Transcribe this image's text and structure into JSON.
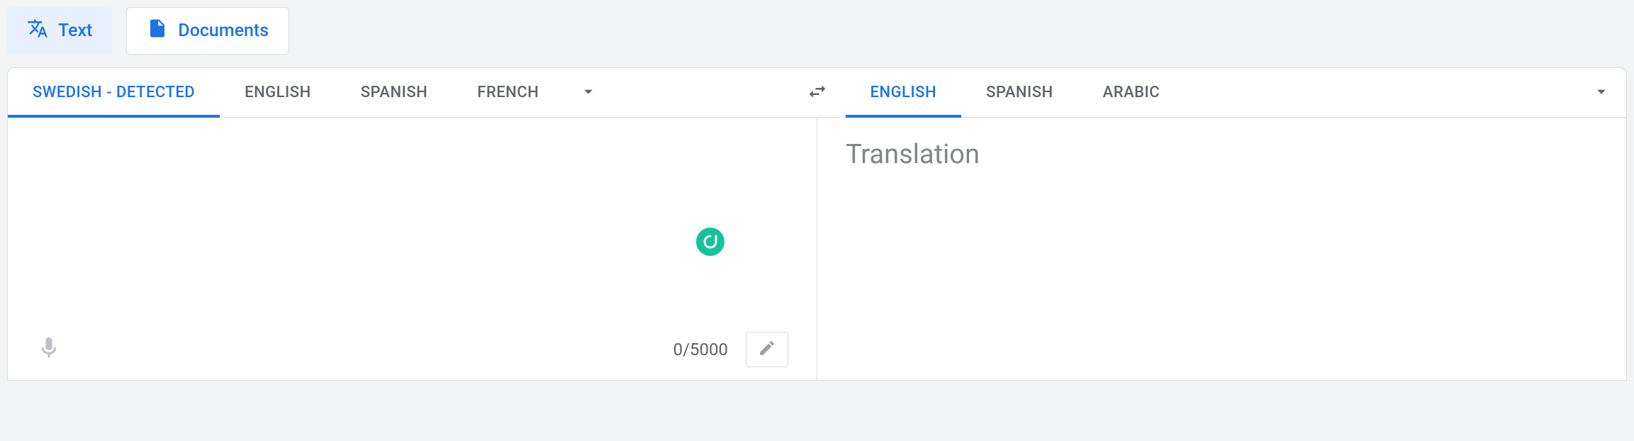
{
  "topTabs": {
    "text": "Text",
    "documents": "Documents"
  },
  "sourceLangs": {
    "detected": "SWEDISH - DETECTED",
    "lang1": "ENGLISH",
    "lang2": "SPANISH",
    "lang3": "FRENCH"
  },
  "targetLangs": {
    "lang1": "ENGLISH",
    "lang2": "SPANISH",
    "lang3": "ARABIC"
  },
  "output": {
    "placeholder": "Translation"
  },
  "charCount": "0/5000"
}
